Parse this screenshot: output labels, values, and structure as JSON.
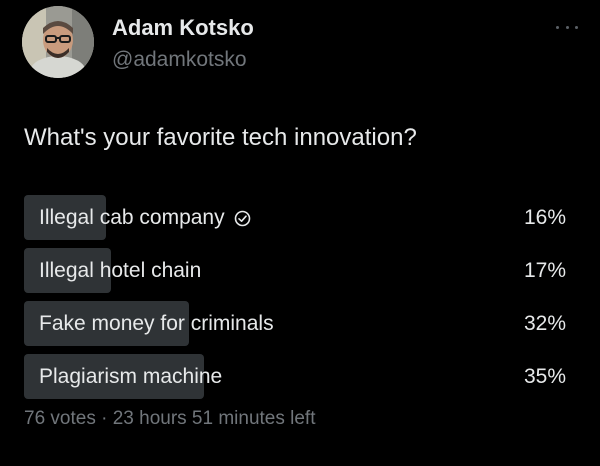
{
  "author": {
    "name": "Adam Kotsko",
    "handle": "@adamkotsko"
  },
  "menu": {
    "icon": "more-horizontal-icon"
  },
  "question": "What's your favorite tech innovation?",
  "poll": {
    "options": [
      {
        "label": "Illegal cab company",
        "percent_text": "16%",
        "percent": 16,
        "selected": true
      },
      {
        "label": "Illegal hotel chain",
        "percent_text": "17%",
        "percent": 17,
        "selected": false
      },
      {
        "label": "Fake money for criminals",
        "percent_text": "32%",
        "percent": 32,
        "selected": false
      },
      {
        "label": "Plagiarism machine",
        "percent_text": "35%",
        "percent": 35,
        "selected": false
      }
    ],
    "footer": "76 votes · 23 hours 51 minutes left"
  },
  "colors": {
    "background": "#000000",
    "text": "#e7e9ea",
    "secondary_text": "#71767b",
    "bar_fill": "#2f3336"
  }
}
